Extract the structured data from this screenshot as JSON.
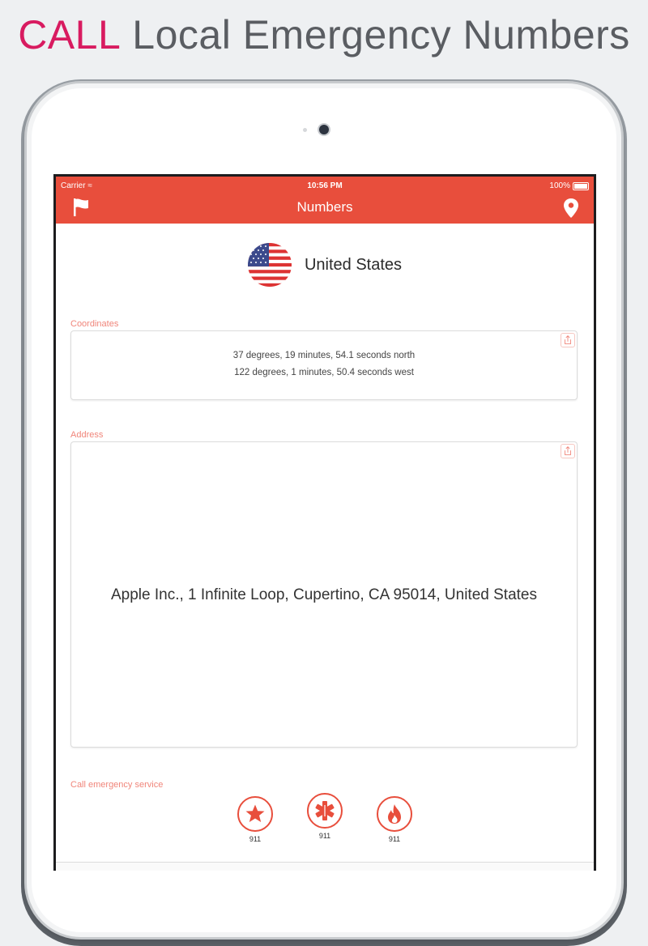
{
  "headline": {
    "accent": "CALL",
    "rest": "Local Emergency Numbers"
  },
  "status_bar": {
    "carrier": "Carrier",
    "time": "10:56 PM",
    "battery": "100%"
  },
  "nav": {
    "title": "Numbers"
  },
  "icons": {
    "left": "flag-icon",
    "right": "location-pin-icon",
    "share": "share-icon"
  },
  "country": {
    "name": "United States"
  },
  "coordinates": {
    "label": "Coordinates",
    "line1": "37 degrees, 19 minutes, 54.1 seconds north",
    "line2": "122 degrees, 1 minutes, 50.4 seconds west"
  },
  "address": {
    "label": "Address",
    "value": "Apple Inc., 1 Infinite Loop, Cupertino, CA  95014, United States"
  },
  "services": {
    "label": "Call emergency service",
    "items": [
      {
        "icon": "police-star-icon",
        "number": "911"
      },
      {
        "icon": "medical-star-icon",
        "number": "911"
      },
      {
        "icon": "fire-icon",
        "number": "911"
      }
    ]
  },
  "colors": {
    "accent": "#e84e3c",
    "headline_accent": "#d81b60",
    "label": "#f0857a"
  }
}
